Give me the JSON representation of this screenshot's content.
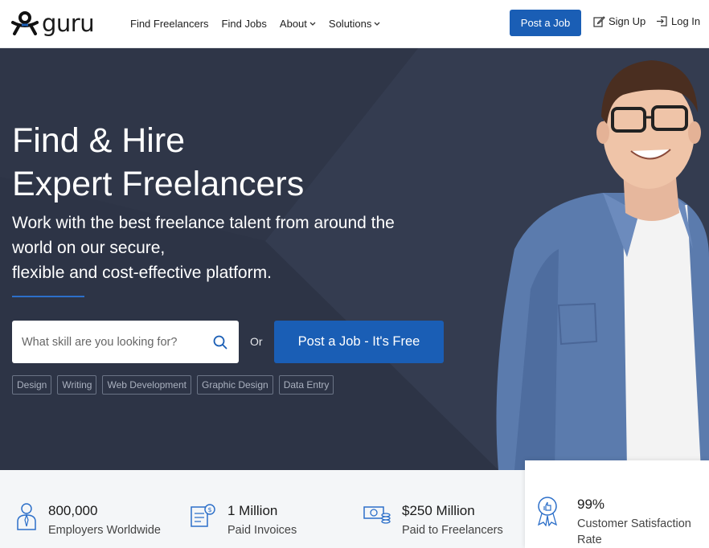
{
  "header": {
    "logo_text": "guru",
    "nav": [
      {
        "label": "Find Freelancers",
        "dropdown": false
      },
      {
        "label": "Find Jobs",
        "dropdown": false
      },
      {
        "label": "About",
        "dropdown": true
      },
      {
        "label": "Solutions",
        "dropdown": true
      }
    ],
    "post_job_label": "Post a Job",
    "signup_label": "Sign Up",
    "login_label": "Log In"
  },
  "hero": {
    "title_line1": "Find & Hire",
    "title_line2": "Expert Freelancers",
    "subtitle_line1": "Work with the best freelance talent from around the",
    "subtitle_line2": "world on our secure,",
    "subtitle_line3": "flexible and cost-effective platform.",
    "search_placeholder": "What skill are you looking for?",
    "or_text": "Or",
    "cta_label": "Post a Job - It's Free",
    "tags": [
      "Design",
      "Writing",
      "Web Development",
      "Graphic Design",
      "Data Entry"
    ]
  },
  "stats": [
    {
      "value": "800,000",
      "label": "Employers Worldwide",
      "icon": "employer-icon"
    },
    {
      "value": "1 Million",
      "label": "Paid Invoices",
      "icon": "invoice-icon"
    },
    {
      "value": "$250 Million",
      "label": "Paid to Freelancers",
      "icon": "money-icon"
    },
    {
      "value": "99%",
      "label_line1": "Customer Satisfaction",
      "label_line2": "Rate",
      "icon": "award-icon"
    }
  ],
  "colors": {
    "brand_blue": "#1a5eb5",
    "hero_bg": "#2d3446",
    "stats_bg": "#f4f6f8"
  }
}
